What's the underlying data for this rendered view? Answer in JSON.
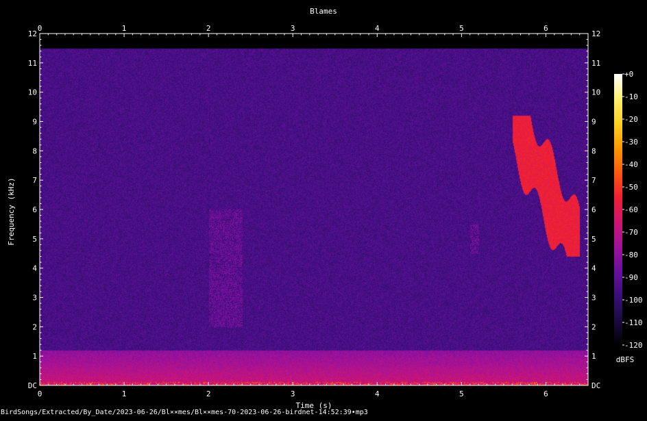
{
  "window": {
    "title": "Blames"
  },
  "footer": {
    "file_path": "BirdSongs/Extracted/By_Date/2023-06-26/Bl××mes/Bl××mes-70-2023-06-26-birdnet-14:52:39•mp3"
  },
  "colors": {
    "background": "#000000",
    "text": "#ffffff",
    "axis": "#ffffff"
  },
  "chart_data": {
    "type": "heatmap",
    "subtype": "spectrogram",
    "title": "Blames",
    "xlabel": "Time (s)",
    "ylabel": "Frequency (kHz)",
    "xlim": [
      0,
      6.5
    ],
    "ylim": [
      0,
      12
    ],
    "x_ticks": [
      "0",
      "1",
      "2",
      "3",
      "4",
      "5",
      "6"
    ],
    "y_ticks": [
      "DC",
      "1",
      "2",
      "3",
      "4",
      "5",
      "6",
      "7",
      "8",
      "9",
      "10",
      "11",
      "12"
    ],
    "colorbar": {
      "label": "dBFS",
      "range": [
        -120,
        0
      ],
      "ticks": [
        "+0",
        "-10",
        "-20",
        "-30",
        "-40",
        "-50",
        "-60",
        "-70",
        "-80",
        "-90",
        "-100",
        "-110",
        "-120"
      ],
      "colormap": [
        "#000000",
        "#1a0b40",
        "#3a0f7a",
        "#6a0fa0",
        "#a0129a",
        "#d01570",
        "#f02030",
        "#ff5a10",
        "#ff9a00",
        "#ffd020",
        "#fff070",
        "#ffffff"
      ]
    },
    "features": [
      {
        "name": "background noise",
        "t": [
          0,
          6.5
        ],
        "f": [
          0,
          11.5
        ],
        "level_dbfs": -95
      },
      {
        "name": "low-frequency noise",
        "t": [
          0,
          6.5
        ],
        "f": [
          0,
          1.2
        ],
        "level_dbfs": -75
      },
      {
        "name": "call",
        "t": [
          5.6,
          6.4
        ],
        "f": [
          4.4,
          9.2
        ],
        "level_dbfs": -60
      },
      {
        "name": "faint call",
        "t": [
          2.0,
          2.4
        ],
        "f": [
          2.0,
          6.0
        ],
        "level_dbfs": -85
      },
      {
        "name": "faint call",
        "t": [
          5.1,
          5.2
        ],
        "f": [
          4.5,
          5.5
        ],
        "level_dbfs": -85
      }
    ]
  }
}
